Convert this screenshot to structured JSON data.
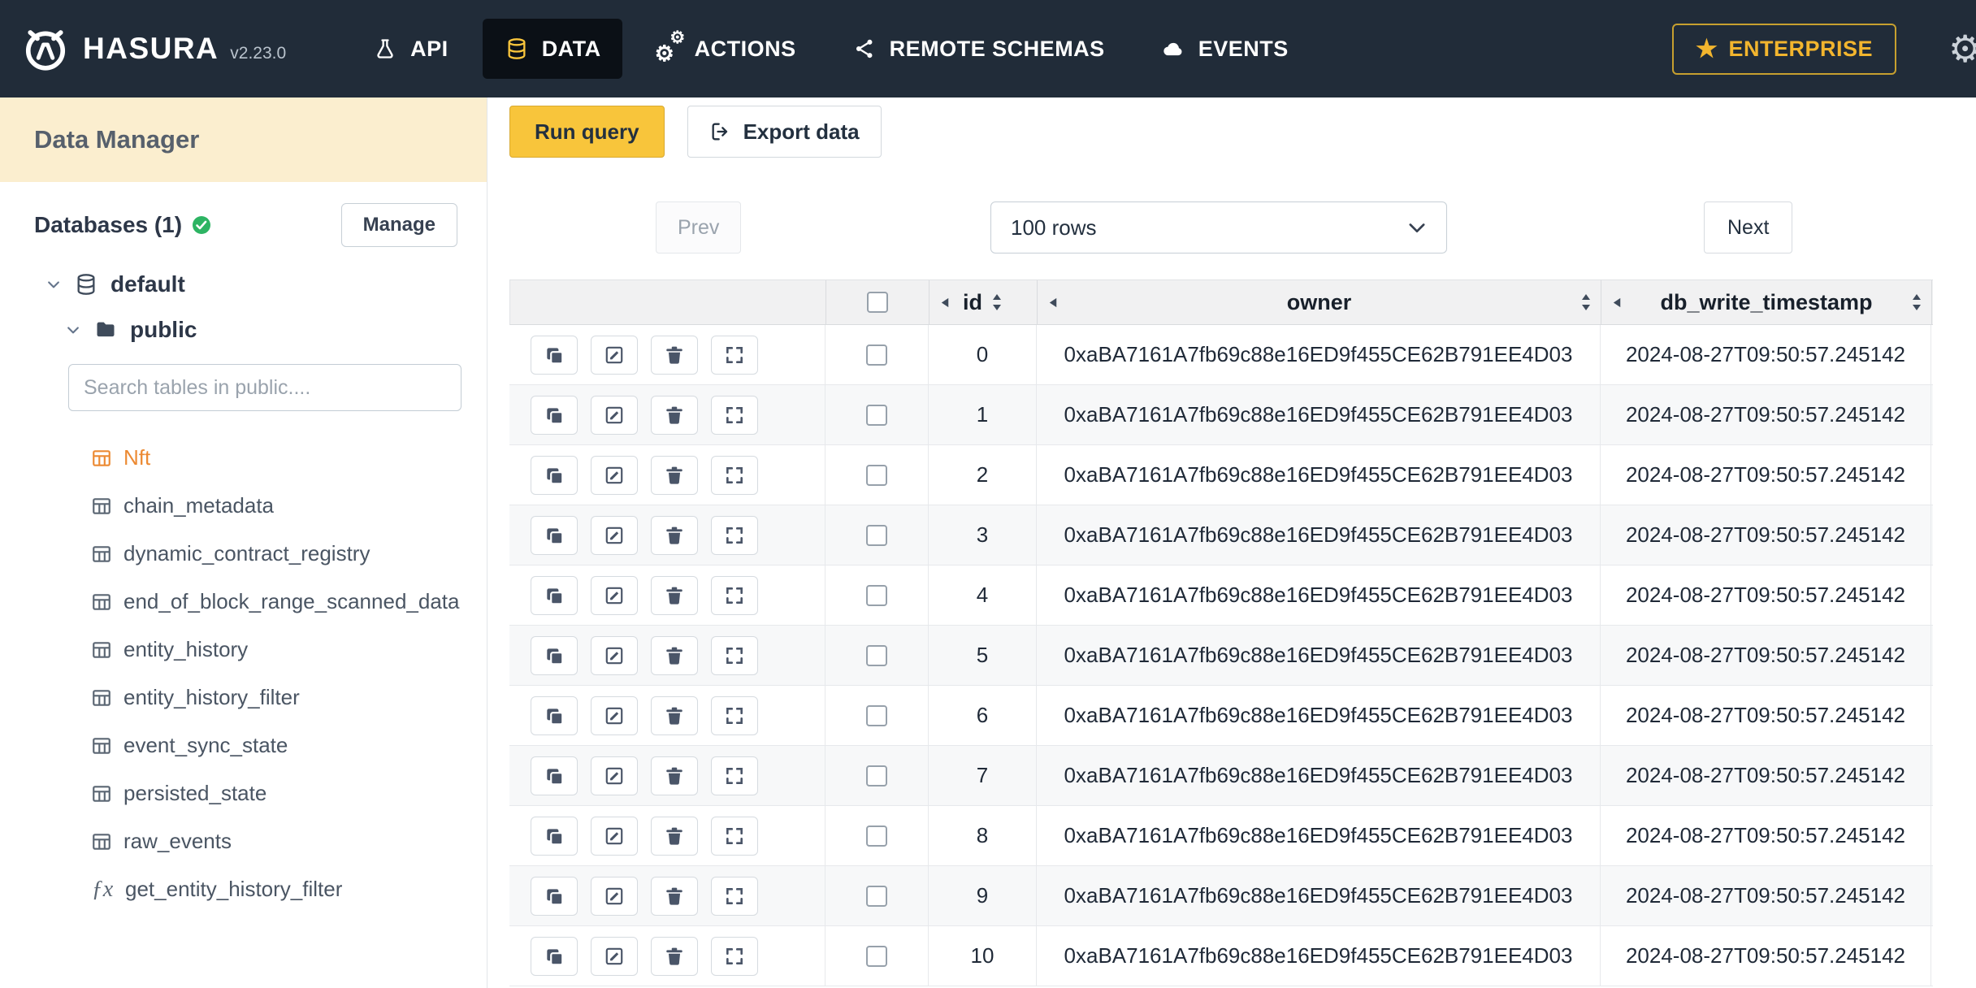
{
  "colors": {
    "navbar_bg": "#212c39",
    "navbar_active_bg": "#0b1016",
    "amber_button": "#f8c53b",
    "enterprise_gold": "#f2b52e",
    "sidebar_header_cream": "#fbeecf",
    "active_table_orange": "#ec8a33",
    "green_check": "#2db463"
  },
  "navbar": {
    "brand": "HASURA",
    "version": "v2.23.0",
    "items": [
      {
        "label": "API"
      },
      {
        "label": "DATA"
      },
      {
        "label": "ACTIONS"
      },
      {
        "label": "REMOTE SCHEMAS"
      },
      {
        "label": "EVENTS"
      }
    ],
    "active_item": "DATA",
    "enterprise_label": "ENTERPRISE"
  },
  "sidebar": {
    "title": "Data Manager",
    "databases_label": "Databases (1)",
    "manage_button": "Manage",
    "database_name": "default",
    "schema_name": "public",
    "search_placeholder": "Search tables in public....",
    "active_table": "Nft",
    "tables": [
      "Nft",
      "chain_metadata",
      "dynamic_contract_registry",
      "end_of_block_range_scanned_data",
      "entity_history",
      "entity_history_filter",
      "event_sync_state",
      "persisted_state",
      "raw_events"
    ],
    "functions": [
      "get_entity_history_filter"
    ]
  },
  "toolbar": {
    "run_query_label": "Run query",
    "export_data_label": "Export data"
  },
  "pagination": {
    "prev_label": "Prev",
    "rows_selected": "100 rows",
    "next_label": "Next"
  },
  "table": {
    "columns": [
      "id",
      "owner",
      "db_write_timestamp"
    ],
    "rows": [
      {
        "id": "0",
        "owner": "0xaBA7161A7fb69c88e16ED9f455CE62B791EE4D03",
        "db_write_timestamp": "2024-08-27T09:50:57.245142"
      },
      {
        "id": "1",
        "owner": "0xaBA7161A7fb69c88e16ED9f455CE62B791EE4D03",
        "db_write_timestamp": "2024-08-27T09:50:57.245142"
      },
      {
        "id": "2",
        "owner": "0xaBA7161A7fb69c88e16ED9f455CE62B791EE4D03",
        "db_write_timestamp": "2024-08-27T09:50:57.245142"
      },
      {
        "id": "3",
        "owner": "0xaBA7161A7fb69c88e16ED9f455CE62B791EE4D03",
        "db_write_timestamp": "2024-08-27T09:50:57.245142"
      },
      {
        "id": "4",
        "owner": "0xaBA7161A7fb69c88e16ED9f455CE62B791EE4D03",
        "db_write_timestamp": "2024-08-27T09:50:57.245142"
      },
      {
        "id": "5",
        "owner": "0xaBA7161A7fb69c88e16ED9f455CE62B791EE4D03",
        "db_write_timestamp": "2024-08-27T09:50:57.245142"
      },
      {
        "id": "6",
        "owner": "0xaBA7161A7fb69c88e16ED9f455CE62B791EE4D03",
        "db_write_timestamp": "2024-08-27T09:50:57.245142"
      },
      {
        "id": "7",
        "owner": "0xaBA7161A7fb69c88e16ED9f455CE62B791EE4D03",
        "db_write_timestamp": "2024-08-27T09:50:57.245142"
      },
      {
        "id": "8",
        "owner": "0xaBA7161A7fb69c88e16ED9f455CE62B791EE4D03",
        "db_write_timestamp": "2024-08-27T09:50:57.245142"
      },
      {
        "id": "9",
        "owner": "0xaBA7161A7fb69c88e16ED9f455CE62B791EE4D03",
        "db_write_timestamp": "2024-08-27T09:50:57.245142"
      },
      {
        "id": "10",
        "owner": "0xaBA7161A7fb69c88e16ED9f455CE62B791EE4D03",
        "db_write_timestamp": "2024-08-27T09:50:57.245142"
      }
    ]
  }
}
